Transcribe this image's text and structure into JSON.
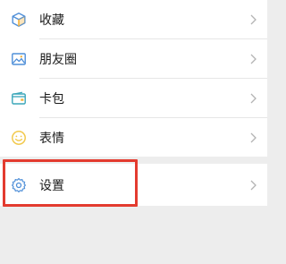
{
  "menu": {
    "items": [
      {
        "label": "收藏",
        "icon": "cube-icon"
      },
      {
        "label": "朋友圈",
        "icon": "photo-icon"
      },
      {
        "label": "卡包",
        "icon": "wallet-icon"
      },
      {
        "label": "表情",
        "icon": "smiley-icon"
      }
    ],
    "settings": {
      "label": "设置",
      "icon": "gear-icon"
    }
  },
  "colors": {
    "page_background": "#ededed",
    "row_background": "#ffffff",
    "highlight_border": "#e33b2f",
    "icon_blue": "#4f8fd8",
    "icon_orange": "#f3b33d",
    "icon_teal": "#3aa6b9",
    "icon_yellow": "#f2c94c"
  }
}
